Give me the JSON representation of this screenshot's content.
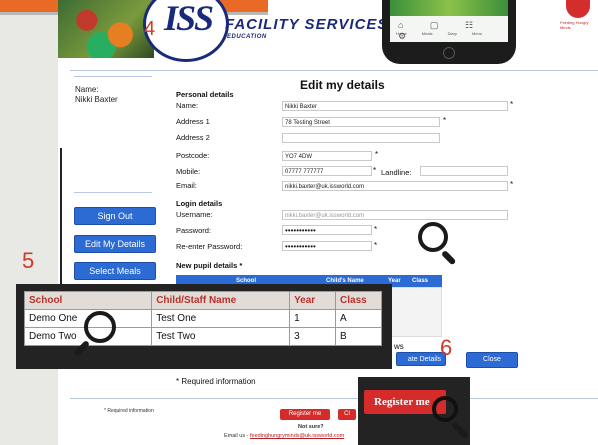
{
  "header": {
    "brand_mark": "ISS",
    "brand_title": "FACILITY SERVICES",
    "brand_subtitle": "EDUCATION",
    "step_4": "4",
    "phone_icons": "⌂ ▢ ☷ ⚙",
    "phone_labels": "Home Meals Diary Menu",
    "hungry_badge_text": "Feeding Hungry Minds"
  },
  "sidebar": {
    "name_label": "Name:",
    "name_value": "Nikki Baxter",
    "buttons": {
      "sign_out": "Sign Out",
      "edit_details": "Edit My Details",
      "select_meals": "Select Meals"
    }
  },
  "form": {
    "title": "Edit my details",
    "personal_heading": "Personal details",
    "fields": {
      "name": {
        "label": "Name:",
        "value": "Nikki Baxter"
      },
      "address1": {
        "label": "Address 1",
        "value": "78 Testing Street"
      },
      "address2": {
        "label": "Address 2",
        "value": ""
      },
      "postcode": {
        "label": "Postcode:",
        "value": "YO7 4DW"
      },
      "mobile": {
        "label": "Mobile:",
        "value": "07777 777777"
      },
      "landline": {
        "label": "Landline:",
        "value": ""
      },
      "email": {
        "label": "Email:",
        "value": "nikki.baxter@uk.issworld.com"
      }
    },
    "login_heading": "Login details",
    "login": {
      "username": {
        "label": "Username:",
        "value": "nikki.baxter@uk.issworld.com"
      },
      "password": {
        "label": "Password:",
        "value": "•••••••••••"
      },
      "reenter": {
        "label": "Re-enter Password:",
        "value": "•••••••••••"
      }
    },
    "required_marker": "*",
    "pupil_heading": "New pupil details *",
    "pupil_bg_headers": [
      "School",
      "Child's Name",
      "Year",
      "Class"
    ],
    "update_partial": "ate Details",
    "close": "Close",
    "required_info": "* Required information",
    "rows_partial": "ws"
  },
  "zoom": {
    "step_5": "5",
    "headers": [
      "School",
      "Child/Staff Name",
      "Year",
      "Class"
    ],
    "rows": [
      [
        "Demo One",
        "Test One",
        "1",
        "A"
      ],
      [
        "Demo Two",
        "Test Two",
        "3",
        "B"
      ]
    ]
  },
  "footer": {
    "required_note": "* Required information",
    "register": "Register me",
    "close_partial": "Cl",
    "not_sure": "Not sure?",
    "email_prefix": "Email us - ",
    "email_link": "feedinghungryminds@uk.issworld.com"
  },
  "callout6": {
    "step_6": "6",
    "register_label": "Register me"
  },
  "colors": {
    "accent_blue": "#2c6bd4",
    "accent_red": "#d52b2b",
    "step_red": "#d13a25",
    "brand_navy": "#1a2a7a"
  }
}
